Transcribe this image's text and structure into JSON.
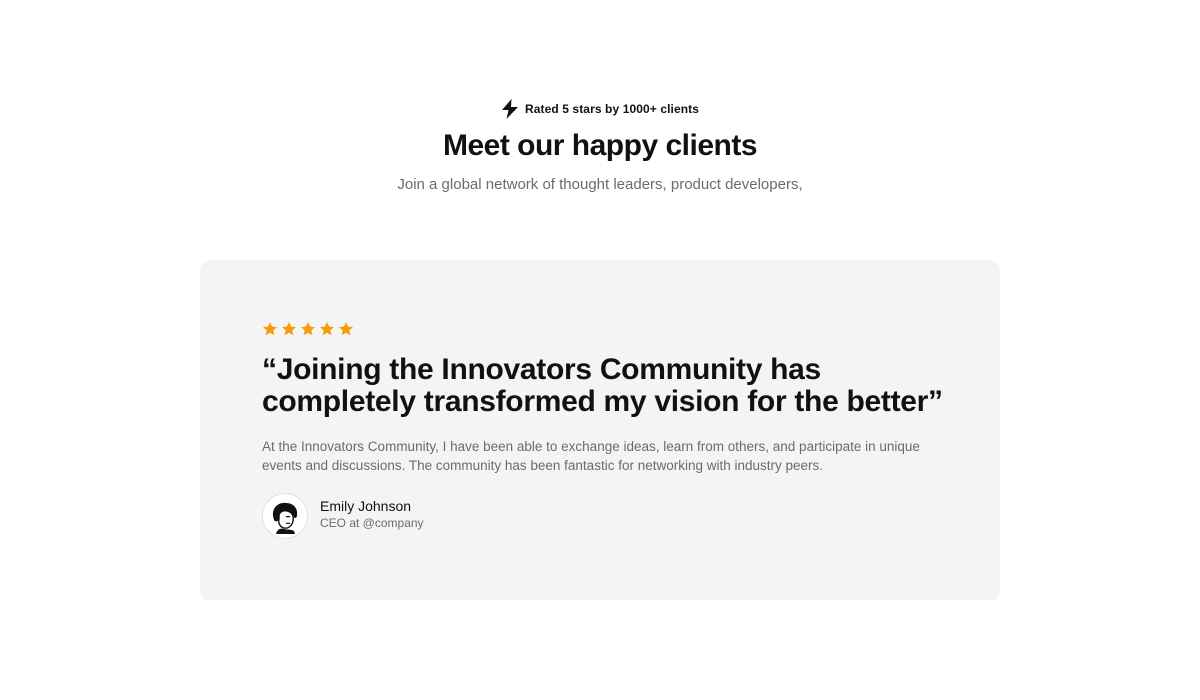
{
  "header": {
    "badge_icon": "lightning-bolt-icon",
    "badge_text": "Rated 5 stars by 1000+ clients",
    "title": "Meet our happy clients",
    "subtitle": "Join a global network of thought leaders, product developers,"
  },
  "testimonial": {
    "rating": 5,
    "rating_max": 5,
    "star_icon": "star-icon",
    "star_color": "#f59e0b",
    "quote": "“Joining the Innovators Community has completely transformed my vision for the better”",
    "body": "At the Innovators Community, I have been able to exchange ideas, learn from others, and participate in unique events and discussions. The community has been fantastic for networking with industry peers.",
    "author": {
      "name": "Emily Johnson",
      "role": "CEO at @company",
      "avatar_icon": "avatar-illustration"
    }
  },
  "colors": {
    "card_background": "#f4f4f4",
    "text_primary": "#111111",
    "text_secondary": "#6b6b6b"
  }
}
